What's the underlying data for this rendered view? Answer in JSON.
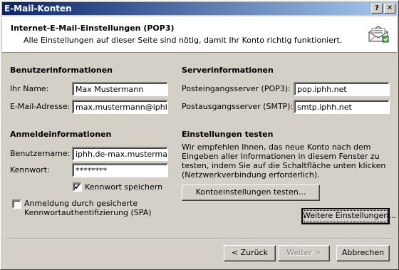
{
  "window": {
    "title": "E-Mail-Konten",
    "help_label": "?",
    "close_label": "✕"
  },
  "header": {
    "title": "Internet-E-Mail-Einstellungen (POP3)",
    "subtitle": "Alle Einstellungen auf dieser Seite sind nötig, damit Ihr Konto richtig funktioniert."
  },
  "user": {
    "section": "Benutzerinformationen",
    "name_label": "Ihr Name:",
    "name_value": "Max Mustermann",
    "email_label": "E-Mail-Adresse:",
    "email_value": "max.mustermann@iphh.de"
  },
  "server": {
    "section": "Serverinformationen",
    "incoming_label": "Posteingangsserver (POP3):",
    "incoming_value": "pop.iphh.net",
    "outgoing_label": "Postausgangsserver (SMTP):",
    "outgoing_value": "smtp.iphh.net"
  },
  "login": {
    "section": "Anmeldeinformationen",
    "username_label": "Benutzername:",
    "username_value": "iphh.de-max.mustermann",
    "password_label": "Kennwort:",
    "password_value": "********",
    "save_password_label": "Kennwort speichern",
    "save_password_checked": true,
    "spa_label": "Anmeldung durch gesicherte Kennwortauthentifizierung (SPA)",
    "spa_checked": false
  },
  "test": {
    "section": "Einstellungen testen",
    "description": "Wir empfehlen Ihnen, das neue Konto nach dem Eingeben aller Informationen in diesem Fenster zu testen, indem Sie auf die Schaltfläche unten klicken (Netzwerkverbindung erforderlich).",
    "button": "Kontoeinstellungen testen..."
  },
  "more_button": "Weitere Einstellungen...",
  "footer": {
    "back": "< Zurück",
    "next": "Weiter >",
    "cancel": "Abbrechen"
  }
}
